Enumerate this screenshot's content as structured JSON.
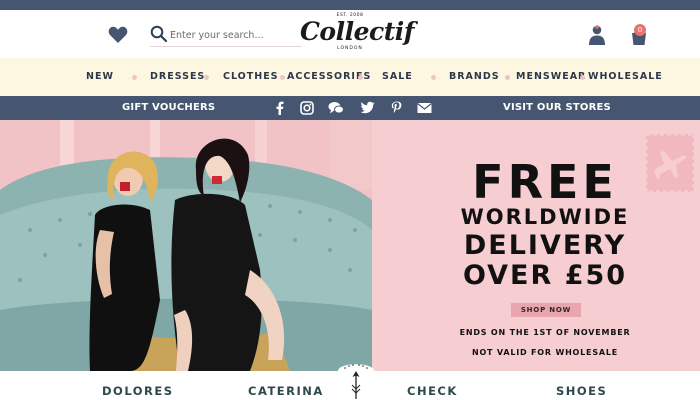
{
  "header": {
    "search": {
      "placeholder": "Enter your search..."
    },
    "logo": {
      "est": "EST. 2008",
      "brand": "Collectif",
      "city": "LONDON"
    },
    "cart_count": "0",
    "icons": [
      "heart-icon",
      "search-icon",
      "user-icon",
      "cart-icon"
    ]
  },
  "nav": {
    "items": [
      "NEW",
      "DRESSES",
      "CLOTHES",
      "ACCESSORIES",
      "SALE",
      "BRANDS",
      "MENSWEAR",
      "WHOLESALE"
    ]
  },
  "subbar": {
    "gift": "GIFT VOUCHERS",
    "visit": "VISIT OUR STORES",
    "social_icons": [
      "facebook-icon",
      "instagram-icon",
      "chat-icon",
      "twitter-icon",
      "pinterest-icon",
      "email-icon"
    ]
  },
  "promo": {
    "line1": "FREE",
    "line2": "WORLDWIDE",
    "line3": "DELIVERY",
    "line4": "OVER £50",
    "cta": "SHOP NOW",
    "note1": "ENDS ON THE 1ST OF NOVEMBER",
    "note2": "NOT VALID FOR WHOLESALE",
    "stamp_icon": "airplane-stamp-icon"
  },
  "categories": [
    "DOLORES",
    "CATERINA",
    "CHECK",
    "SHOES"
  ],
  "colors": {
    "topbar": "#465670",
    "nav_bg": "#fdf7e1",
    "promo_bg": "#f6cdd1",
    "cta_bg": "#e8a5ad",
    "hero_wall": "#efbcc0",
    "sofa": "#8fb6b4"
  }
}
